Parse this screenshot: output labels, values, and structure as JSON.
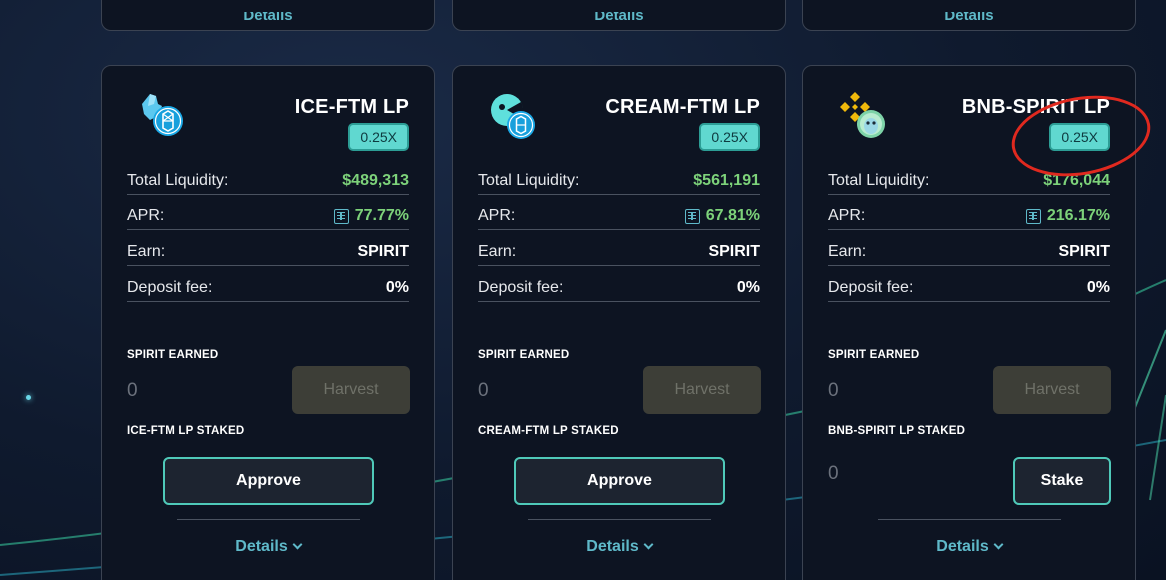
{
  "top_cards": [
    {
      "details_label": "Details"
    },
    {
      "details_label": "Details"
    },
    {
      "details_label": "Details"
    }
  ],
  "farms": [
    {
      "pair_name": "ICE-FTM LP",
      "multiplier": "0.25X",
      "logo_icon": "ice-ftm-token-pair-icon",
      "total_liquidity_label": "Total Liquidity:",
      "total_liquidity": "$489,313",
      "apr_label": "APR:",
      "apr": "77.77%",
      "earn_label": "Earn:",
      "earn": "SPIRIT",
      "deposit_fee_label": "Deposit fee:",
      "deposit_fee": "0%",
      "earned_label": "SPIRIT EARNED",
      "earned_value": "0",
      "harvest_label": "Harvest",
      "staked_label": "ICE-FTM LP STAKED",
      "action_label": "Approve",
      "details_label": "Details"
    },
    {
      "pair_name": "CREAM-FTM LP",
      "multiplier": "0.25X",
      "logo_icon": "cream-ftm-token-pair-icon",
      "total_liquidity_label": "Total Liquidity:",
      "total_liquidity": "$561,191",
      "apr_label": "APR:",
      "apr": "67.81%",
      "earn_label": "Earn:",
      "earn": "SPIRIT",
      "deposit_fee_label": "Deposit fee:",
      "deposit_fee": "0%",
      "earned_label": "SPIRIT EARNED",
      "earned_value": "0",
      "harvest_label": "Harvest",
      "staked_label": "CREAM-FTM LP STAKED",
      "action_label": "Approve",
      "details_label": "Details"
    },
    {
      "pair_name": "BNB-SPIRIT LP",
      "multiplier": "0.25X",
      "logo_icon": "bnb-spirit-token-pair-icon",
      "total_liquidity_label": "Total Liquidity:",
      "total_liquidity": "$176,044",
      "apr_label": "APR:",
      "apr": "216.17%",
      "earn_label": "Earn:",
      "earn": "SPIRIT",
      "deposit_fee_label": "Deposit fee:",
      "deposit_fee": "0%",
      "earned_label": "SPIRIT EARNED",
      "earned_value": "0",
      "harvest_label": "Harvest",
      "staked_label": "BNB-SPIRIT LP STAKED",
      "staked_value": "0",
      "action_label": "Stake",
      "details_label": "Details"
    }
  ],
  "colors": {
    "accent_teal": "#5fb9c9",
    "positive_green": "#7dd27a",
    "multiplier_badge": "#60d8d0",
    "annotation_red": "#e0291f"
  }
}
